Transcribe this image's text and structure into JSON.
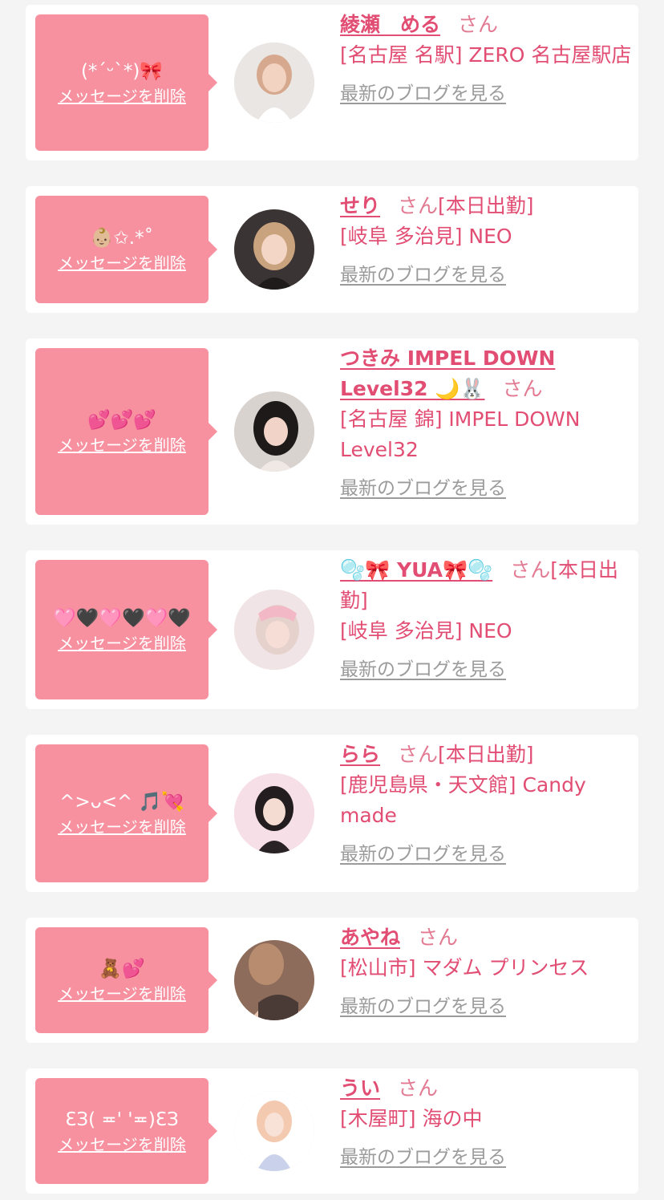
{
  "delete_label": "メッセージを削除",
  "blog_label": "最新のブログを見る",
  "san_label": "さん",
  "colors": {
    "bubble": "#f7909f",
    "accent": "#e24d73",
    "link_gray": "#9b9b9b",
    "background": "#f4f4f4"
  },
  "items": [
    {
      "message": "(*ˊᵕˋ*)🎀",
      "name": "綾瀬　める",
      "status": "",
      "store": "[名古屋 名駅] ZERO 名古屋駅店"
    },
    {
      "message": "👶🏼✩.*˚",
      "name": "せり",
      "status": "[本日出勤]",
      "store": "[岐阜 多治見] NEO"
    },
    {
      "message": "💕💕💕",
      "name": "つきみ IMPEL DOWN Level32 🌙🐰",
      "status": "",
      "store": "[名古屋 錦] IMPEL DOWN Level32"
    },
    {
      "message": "🩷🖤🩷🖤🩷🖤",
      "name": "🫧🎀 YUA🎀🫧",
      "status": "[本日出勤]",
      "store": "[岐阜 多治見] NEO"
    },
    {
      "message": "^>ᴗ<^ 🎵💘",
      "name": "らら",
      "status": "[本日出勤]",
      "store": "[鹿児島県・天文館] Candy made"
    },
    {
      "message": "🧸💕",
      "name": "あやね",
      "status": "",
      "store": "[松山市] マダム プリンセス"
    },
    {
      "message": "ƐЗ( ≖' '≖)ƐЗ",
      "name": "うい",
      "status": "",
      "store": "[木屋町] 海の中"
    }
  ]
}
